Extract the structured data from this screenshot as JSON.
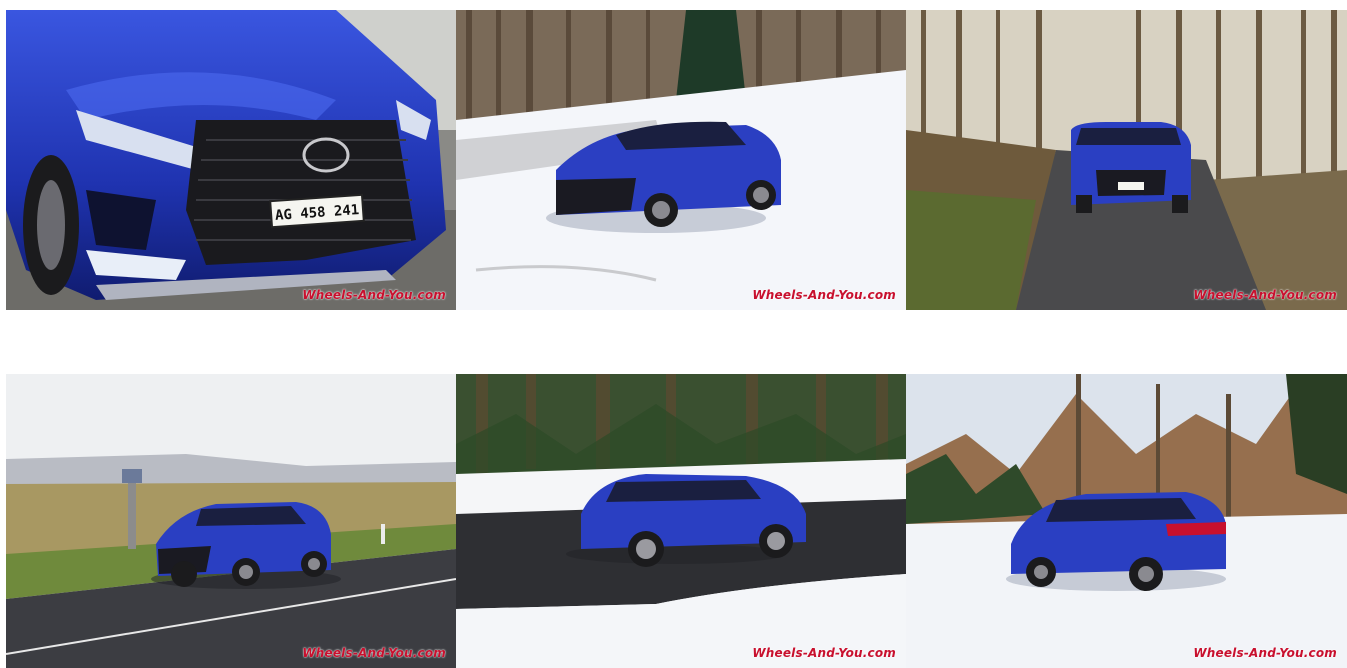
{
  "gallery": {
    "photos": [
      {
        "alt": "Lexus RX front grille close-up",
        "plate": "AG 458 241",
        "watermark": "Wheels-And-You.com"
      },
      {
        "alt": "Lexus RX on snowy field",
        "watermark": "Wheels-And-You.com"
      },
      {
        "alt": "Lexus RX on forest road",
        "watermark": "Wheels-And-You.com"
      },
      {
        "alt": "Lexus RX on country road",
        "watermark": "Wheels-And-You.com"
      },
      {
        "alt": "Lexus RX driving through snowy curve",
        "watermark": "Wheels-And-You.com"
      },
      {
        "alt": "Lexus RX rear view in snow",
        "watermark": "Wheels-And-You.com"
      }
    ]
  },
  "colors": {
    "car_blue": "#2a3fc0",
    "watermark_red": "#c8102e",
    "snow": "#f2f4f8",
    "forest": "#5b5040"
  }
}
